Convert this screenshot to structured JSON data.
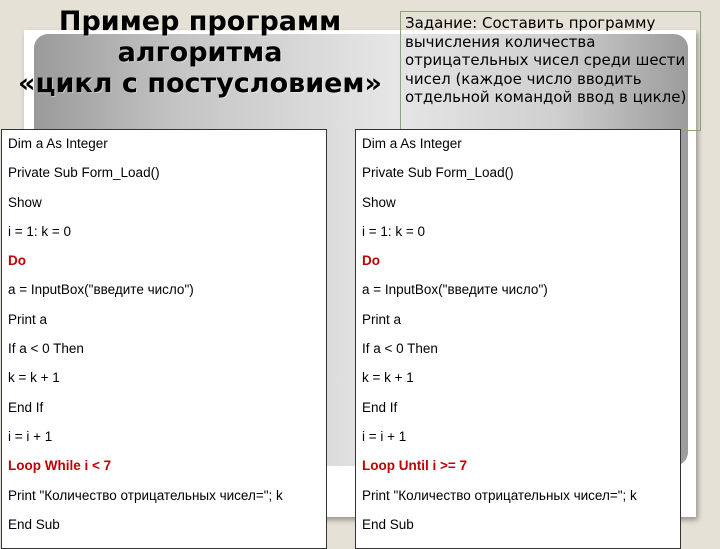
{
  "slide": {
    "title_lines": [
      "Пример программ",
      "алгоритма",
      "«цикл с постусловием»"
    ],
    "task_text": "Задание: Составить программу вычисления количества отрицательных чисел среди шести чисел (каждое число вводить отдельной командой ввод в цикле)",
    "accent_color": "#c00000",
    "left_code": [
      {
        "text": "Dim a As Integer",
        "keyword": false
      },
      {
        "text": "Private Sub Form_Load()",
        "keyword": false
      },
      {
        "text": "Show",
        "keyword": false
      },
      {
        "text": "i = 1: k = 0",
        "keyword": false
      },
      {
        "text": "Do",
        "keyword": true
      },
      {
        "text": "a = InputBox(\"введите число\")",
        "keyword": false
      },
      {
        "text": "Print a",
        "keyword": false
      },
      {
        "text": "If a < 0 Then",
        "keyword": false
      },
      {
        "text": "k = k + 1",
        "keyword": false
      },
      {
        "text": "End If",
        "keyword": false
      },
      {
        "text": "i = i + 1",
        "keyword": false
      },
      {
        "text": "Loop While i < 7",
        "keyword": true
      },
      {
        "text": "Print \"Количество отрицательных чисел=\"; k",
        "keyword": false
      },
      {
        "text": "End Sub",
        "keyword": false
      }
    ],
    "right_code": [
      {
        "text": "Dim a As Integer",
        "keyword": false
      },
      {
        "text": "Private Sub Form_Load()",
        "keyword": false
      },
      {
        "text": "Show",
        "keyword": false
      },
      {
        "text": "i = 1: k = 0",
        "keyword": false
      },
      {
        "text": "Do",
        "keyword": true
      },
      {
        "text": "a = InputBox(\"введите число\")",
        "keyword": false
      },
      {
        "text": "Print a",
        "keyword": false
      },
      {
        "text": "If a < 0 Then",
        "keyword": false
      },
      {
        "text": "k = k + 1",
        "keyword": false
      },
      {
        "text": "End If",
        "keyword": false
      },
      {
        "text": "i = i + 1",
        "keyword": false
      },
      {
        "text": "Loop  Until i >= 7",
        "keyword": true
      },
      {
        "text": "Print \"Количество отрицательных чисел=\"; k",
        "keyword": false
      },
      {
        "text": "End Sub",
        "keyword": false
      }
    ]
  }
}
